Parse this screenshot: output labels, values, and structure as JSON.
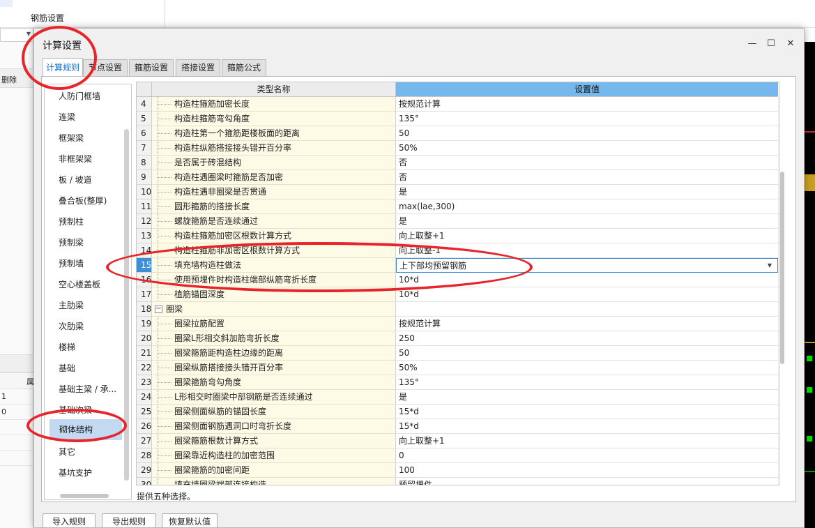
{
  "background": {
    "section_title": "钢筋设置",
    "left_panel": {
      "delete_label": "删除",
      "column_header": "属",
      "rows": [
        "1",
        "0"
      ]
    }
  },
  "dialog": {
    "title": "计算设置",
    "window_controls": {
      "minimize": "—",
      "maximize": "☐",
      "close": "✕"
    },
    "tabs": [
      {
        "label": "计算规则",
        "active": true
      },
      {
        "label": "节点设置",
        "active": false
      },
      {
        "label": "箍筋设置",
        "active": false
      },
      {
        "label": "搭接设置",
        "active": false
      },
      {
        "label": "箍筋公式",
        "active": false
      }
    ],
    "categories": [
      "人防门框墙",
      "连梁",
      "框架梁",
      "非框架梁",
      "板 / 坡道",
      "叠合板(整厚)",
      "预制柱",
      "预制梁",
      "预制墙",
      "空心楼盖板",
      "主肋梁",
      "次肋梁",
      "楼梯",
      "基础",
      "基础主梁 / 承...",
      "基础次梁",
      "砌体结构",
      "其它",
      "基坑支护"
    ],
    "selected_category": "砌体结构",
    "grid": {
      "col_name": "类型名称",
      "col_value": "设置值",
      "current_row": "15",
      "rows": [
        {
          "num": "4",
          "name": "构造柱箍筋加密长度",
          "value": "按规范计算"
        },
        {
          "num": "5",
          "name": "构造柱箍筋弯勾角度",
          "value": "135°"
        },
        {
          "num": "6",
          "name": "构造柱第一个箍筋距楼板面的距离",
          "value": "50"
        },
        {
          "num": "7",
          "name": "构造柱纵筋搭接接头错开百分率",
          "value": "50%"
        },
        {
          "num": "8",
          "name": "是否属于砖混结构",
          "value": "否"
        },
        {
          "num": "9",
          "name": "构造柱遇圈梁时箍筋是否加密",
          "value": "否"
        },
        {
          "num": "10",
          "name": "构造柱遇非圈梁是否贯通",
          "value": "是"
        },
        {
          "num": "11",
          "name": "圆形箍筋的搭接长度",
          "value": "max(lae,300)"
        },
        {
          "num": "12",
          "name": "螺旋箍筋是否连续通过",
          "value": "是"
        },
        {
          "num": "13",
          "name": "构造柱箍筋加密区根数计算方式",
          "value": "向上取整+1"
        },
        {
          "num": "14",
          "name": "构造柱箍筋非加密区根数计算方式",
          "value": "向上取整-1"
        },
        {
          "num": "15",
          "name": "填充墙构造柱做法",
          "value": "上下部均预留钢筋"
        },
        {
          "num": "16",
          "name": "使用预埋件时构造柱端部纵筋弯折长度",
          "value": "10*d"
        },
        {
          "num": "17",
          "name": "植筋锚固深度",
          "value": "10*d"
        },
        {
          "num": "18",
          "name": "圈梁",
          "value": "",
          "group": true,
          "expander": "−"
        },
        {
          "num": "19",
          "name": "圈梁拉筋配置",
          "value": "按规范计算"
        },
        {
          "num": "20",
          "name": "圈梁L形相交斜加筋弯折长度",
          "value": "250"
        },
        {
          "num": "21",
          "name": "圈梁箍筋距构造柱边缘的距离",
          "value": "50"
        },
        {
          "num": "22",
          "name": "圈梁纵筋搭接接头错开百分率",
          "value": "50%"
        },
        {
          "num": "23",
          "name": "圈梁箍筋弯勾角度",
          "value": "135°"
        },
        {
          "num": "24",
          "name": "L形相交时圈梁中部钢筋是否连续通过",
          "value": "是"
        },
        {
          "num": "25",
          "name": "圈梁侧面纵筋的锚固长度",
          "value": "15*d"
        },
        {
          "num": "26",
          "name": "圈梁侧面钢筋遇洞口时弯折长度",
          "value": "15*d"
        },
        {
          "num": "27",
          "name": "圈梁箍筋根数计算方式",
          "value": "向上取整+1"
        },
        {
          "num": "28",
          "name": "圈梁靠近构造柱的加密范围",
          "value": "0"
        },
        {
          "num": "29",
          "name": "圈梁箍筋的加密间距",
          "value": "100"
        },
        {
          "num": "30",
          "name": "填充墙圈梁端部连接构造",
          "value": "预留埋件"
        }
      ]
    },
    "hint": "提供五种选择。",
    "buttons": {
      "import": "导入规则",
      "export": "导出规则",
      "restore": "恢复默认值"
    }
  },
  "colors": {
    "annotation_red": "#e8232a",
    "header_blue": "#77b8ec",
    "selection_blue": "#3d8fd6",
    "name_cell_bg": "#fdfbe6"
  }
}
